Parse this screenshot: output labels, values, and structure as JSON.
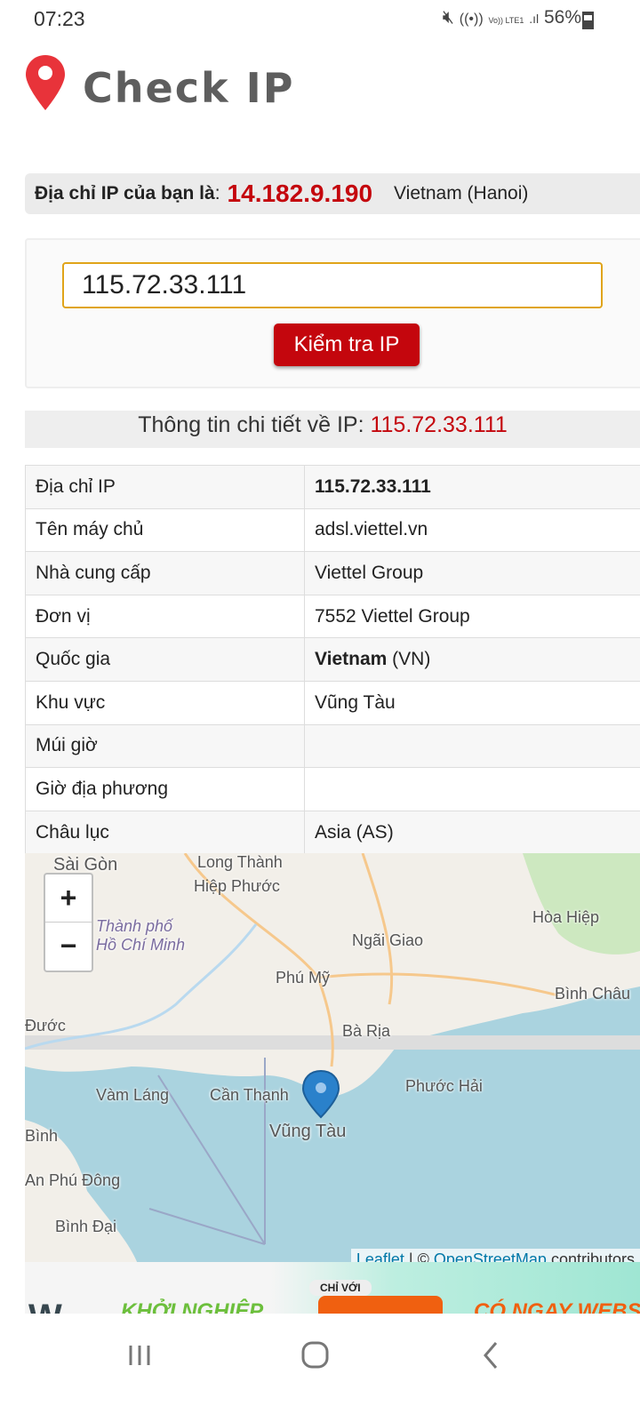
{
  "status_bar": {
    "time": "07:23",
    "icons": [
      "mute-icon",
      "wifi-icon",
      "volte-icon",
      "signal-icon"
    ],
    "volte": "Vo)) LTE1",
    "battery": "56%",
    "battery_level": 56
  },
  "header": {
    "logo_text": "Check IP",
    "logo_icon": "map-pin-icon",
    "logo_color": "#e8333a"
  },
  "my_ip": {
    "label": "Địa chỉ IP của bạn là",
    "ip": "14.182.9.190",
    "location": "Vietnam (Hanoi)"
  },
  "lookup": {
    "input_value": "115.72.33.111",
    "button": "Kiểm tra IP"
  },
  "details": {
    "title": "Thông tin chi tiết về IP:",
    "ip": "115.72.33.111",
    "rows": [
      {
        "label": "Địa chỉ IP",
        "value": "115.72.33.111",
        "bold": true
      },
      {
        "label": "Tên máy chủ",
        "value": "adsl.viettel.vn"
      },
      {
        "label": "Nhà cung cấp",
        "value": "Viettel Group"
      },
      {
        "label": "Đơn vị",
        "value": "7552 Viettel Group"
      },
      {
        "label": "Quốc gia",
        "value": "Vietnam",
        "suffix": " (VN)"
      },
      {
        "label": "Khu vực",
        "value": "Vũng Tàu"
      },
      {
        "label": "Múi giờ",
        "value": ""
      },
      {
        "label": "Giờ địa phương",
        "value": ""
      },
      {
        "label": "Châu lục",
        "value": "Asia (AS)"
      }
    ]
  },
  "map": {
    "zoom_in": "+",
    "zoom_out": "−",
    "labels": [
      "Sài Gòn",
      "Long Thành",
      "Hiệp Phước",
      "Thành phố Hồ Chí Minh",
      "Ngãi Giao",
      "Hòa Hiệp",
      "Phú Mỹ",
      "Bình Châu",
      "Đước",
      "Bà Rịa",
      "Phước Hải",
      "Vàm Láng",
      "Cần Thạnh",
      "Vũng Tàu",
      "Bình",
      "An Phú Đông",
      "Bình Đại"
    ],
    "attribution": {
      "leaflet": "Leaflet",
      "sep": " | © ",
      "osm": "OpenStreetMap",
      "rest": " contributors"
    }
  },
  "ad": {
    "text1": "KHỞI NGHIỆP",
    "text2": "CHỈ VỚI",
    "text3": "CÓ NGAY WEBSITE"
  },
  "nav": {
    "recent": "recent-apps-icon",
    "home": "home-icon",
    "back": "back-icon"
  }
}
